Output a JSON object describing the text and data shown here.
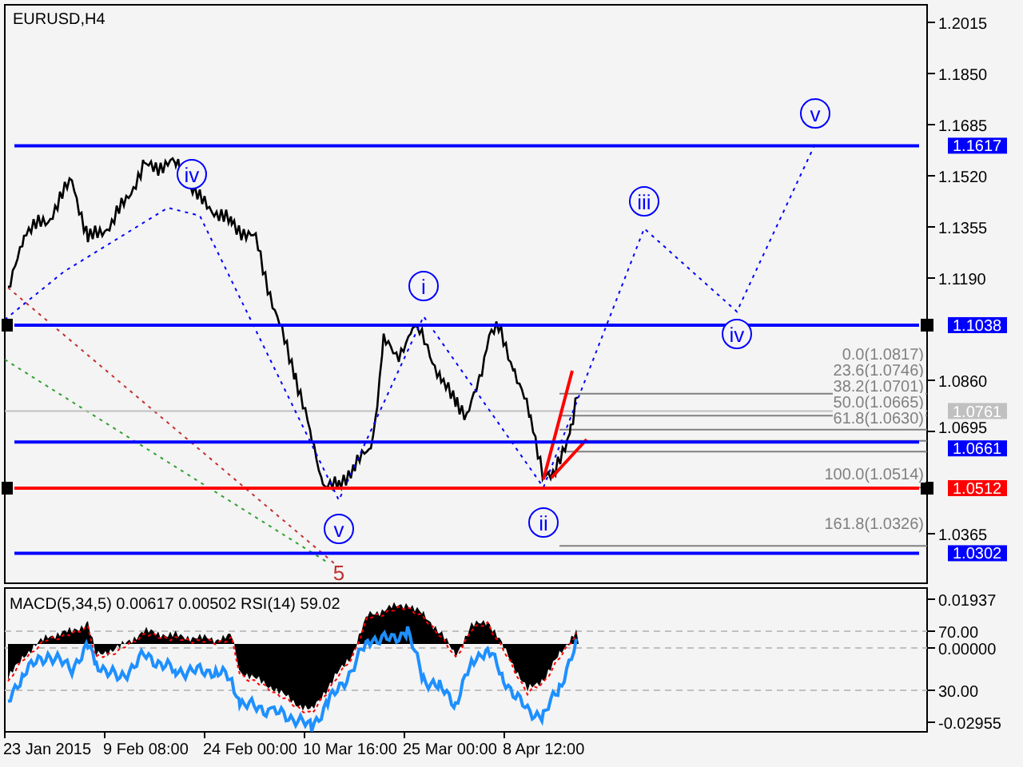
{
  "chart": {
    "title": "EURUSD,H4",
    "price_axis": [
      "1.2015",
      "1.1850",
      "1.1685",
      "1.1520",
      "1.1355",
      "1.1190",
      "1.0860",
      "1.0695",
      "1.0365"
    ],
    "level_lines": [
      {
        "label": "1.1617",
        "color": "#0000ff",
        "selected": false
      },
      {
        "label": "1.1038",
        "color": "#0000ff",
        "selected": true
      },
      {
        "label": "1.0661",
        "color": "#0000ff",
        "selected": false
      },
      {
        "label": "1.0512",
        "color": "#ff0000",
        "selected": true
      },
      {
        "label": "1.0302",
        "color": "#0000ff",
        "selected": false
      }
    ],
    "current_price": "1.0761",
    "fibonacci": [
      "0.0(1.0817)",
      "23.6(1.0746)",
      "38.2(1.0701)",
      "50.0(1.0665)",
      "61.8(1.0630)",
      "100.0(1.0514)",
      "161.8(1.0326)"
    ],
    "wave_labels": [
      {
        "text": "iv",
        "kind": "circled"
      },
      {
        "text": "v",
        "kind": "circled"
      },
      {
        "text": "i",
        "kind": "circled"
      },
      {
        "text": "ii",
        "kind": "circled"
      },
      {
        "text": "iii",
        "kind": "circled"
      },
      {
        "text": "iv",
        "kind": "circled"
      },
      {
        "text": "v",
        "kind": "circled"
      },
      {
        "text": "5",
        "kind": "plain"
      }
    ]
  },
  "indicator": {
    "title": "MACD(5,34,5) 0.00617 0.00502 RSI(14) 59.02",
    "axis": [
      {
        "label": "0.01937",
        "kind": "macd"
      },
      {
        "label": "70.00",
        "kind": "rsi"
      },
      {
        "label": "0.00000",
        "kind": "macd"
      },
      {
        "label": "30.00",
        "kind": "rsi"
      },
      {
        "label": "-0.02955",
        "kind": "macd"
      }
    ]
  },
  "time_axis": [
    "23 Jan 2015",
    "9 Feb 08:00",
    "24 Feb 00:00",
    "10 Mar 16:00",
    "25 Mar 00:00",
    "8 Apr 12:00"
  ]
}
